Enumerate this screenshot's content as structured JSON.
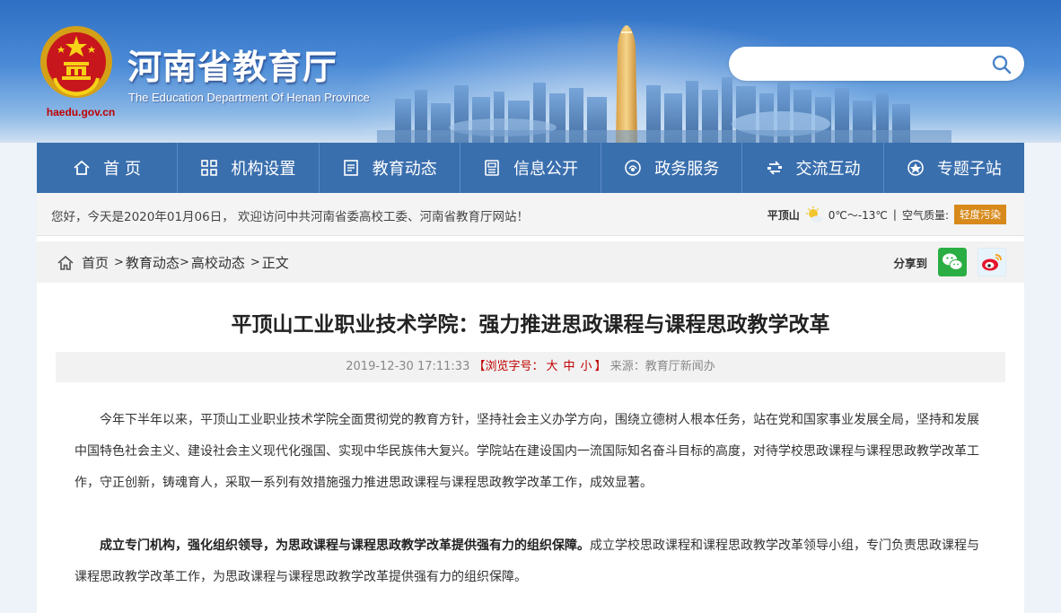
{
  "header": {
    "title": "河南省教育厅",
    "subtitle": "The Education Department Of Henan Province",
    "domain": "haedu.gov.cn",
    "search_placeholder": ""
  },
  "nav": {
    "items": [
      {
        "label": "首 页",
        "icon": "home-icon"
      },
      {
        "label": "机构设置",
        "icon": "org-icon"
      },
      {
        "label": "教育动态",
        "icon": "news-icon"
      },
      {
        "label": "信息公开",
        "icon": "info-icon"
      },
      {
        "label": "政务服务",
        "icon": "service-icon"
      },
      {
        "label": "交流互动",
        "icon": "interaction-icon"
      },
      {
        "label": "专题子站",
        "icon": "subsite-icon"
      }
    ]
  },
  "infobar": {
    "welcome": "您好，今天是2020年01月06日， 欢迎访问中共河南省委高校工委、河南省教育厅网站！",
    "weather_city": "平顶山",
    "weather_temp": "0℃～-13℃",
    "weather_sep": "|",
    "air_label": "空气质量:",
    "air_quality": "轻度污染"
  },
  "breadcrumb": {
    "home": "首页",
    "items": [
      "教育动态",
      "高校动态",
      "正文"
    ],
    "sep": ">"
  },
  "share": {
    "label": "分享到",
    "targets": [
      "wechat-icon",
      "weibo-icon"
    ]
  },
  "article": {
    "title": "平顶山工业职业技术学院：强力推进思政课程与课程思政教学改革",
    "date": "2019-12-30 17:11:33",
    "font_label_open": "【浏览字号：",
    "size_large": "大",
    "size_medium": "中",
    "size_small": "小",
    "font_label_close": "】",
    "source": "来源：教育厅新闻办",
    "paragraph1": "今年下半年以来，平顶山工业职业技术学院全面贯彻党的教育方针，坚持社会主义办学方向，围绕立德树人根本任务，站在党和国家事业发展全局，坚持和发展中国特色社会主义、建设社会主义现代化强国、实现中华民族伟大复兴。学院站在建设国内一流国际知名奋斗目标的高度，对待学校思政课程与课程思政教学改革工作，守正创新，铸魂育人，采取一系列有效措施强力推进思政课程与课程思政教学改革工作，成效显著。",
    "paragraph2_bold": "成立专门机构，强化组织领导，为思政课程与课程思政教学改革提供强有力的组织保障。",
    "paragraph2_rest": "成立学校思政课程和课程思政教学改革领导小组，专门负责思政课程与课程思政教学改革工作，为思政课程与课程思政教学改革提供强有力的组织保障。"
  },
  "colors": {
    "nav_bg": "#3a6fae",
    "air_badge": "#d78a1b",
    "accent_red": "#c00000"
  }
}
